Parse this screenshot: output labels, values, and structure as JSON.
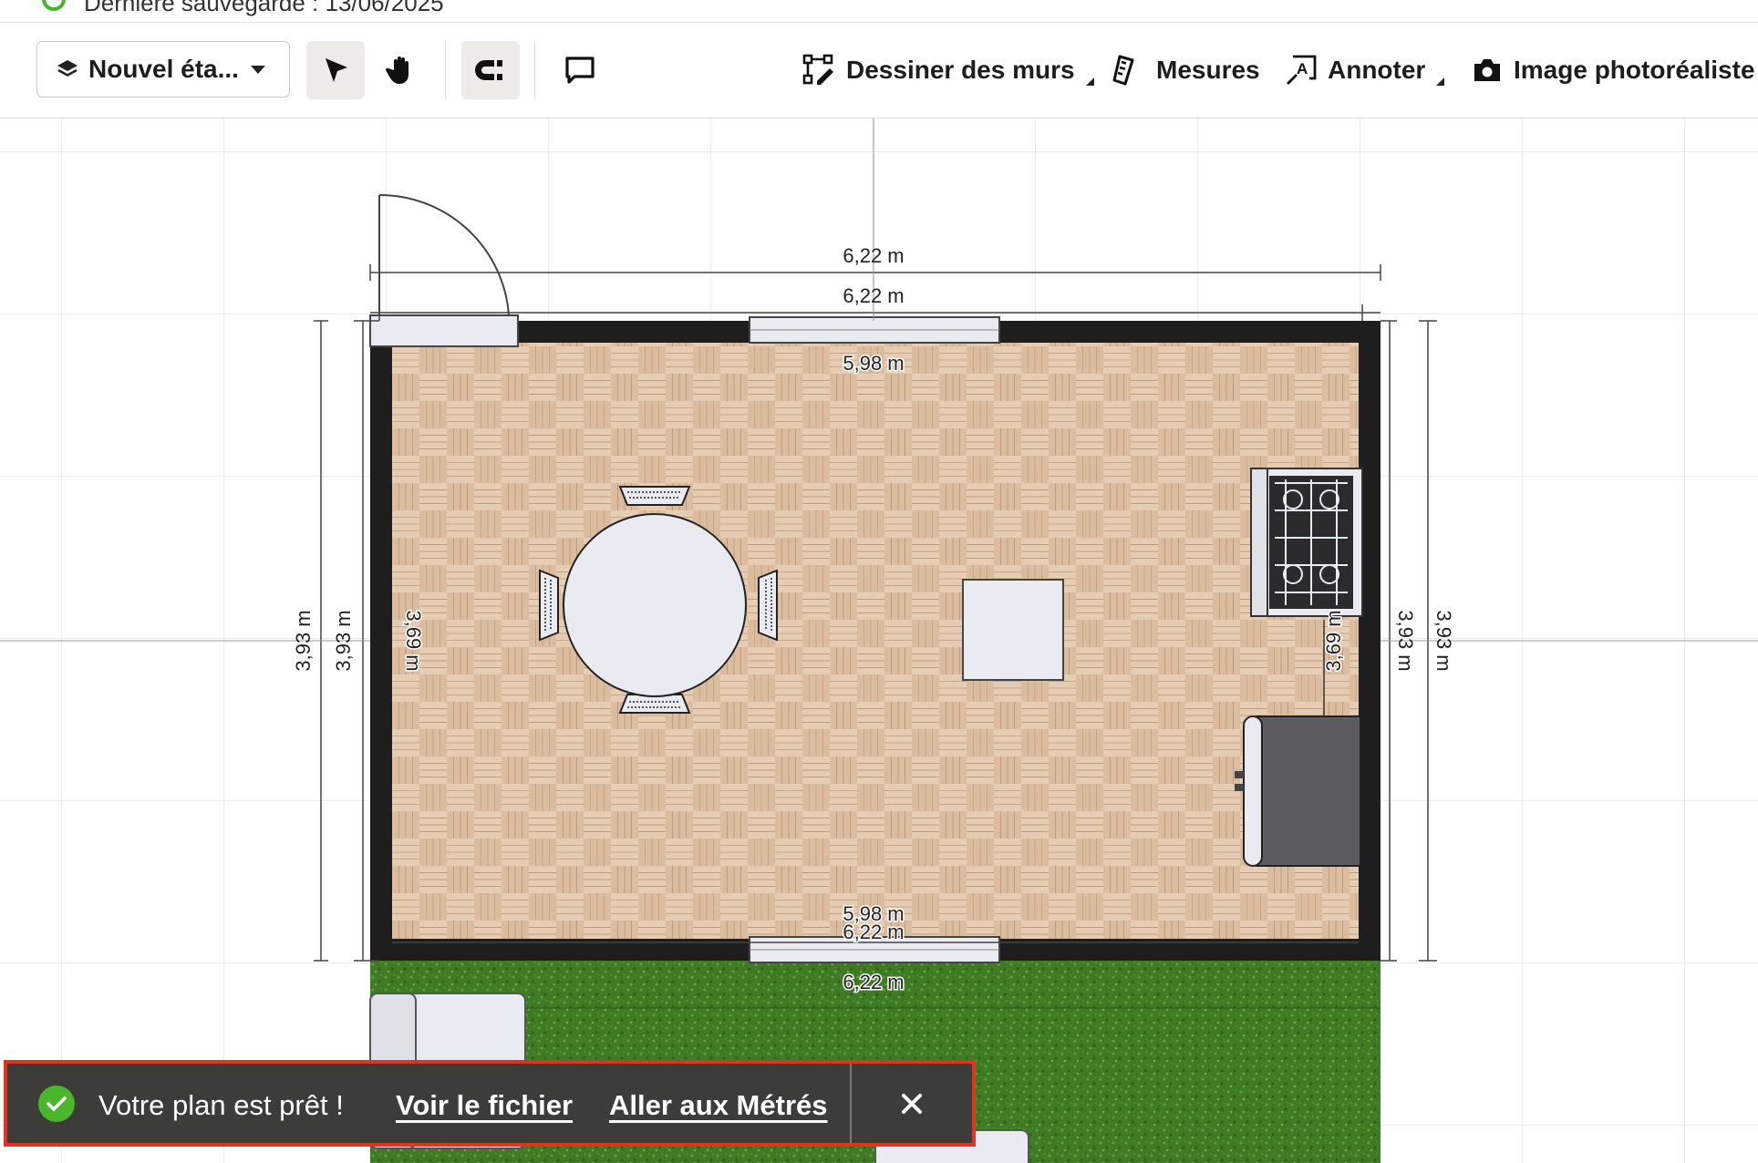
{
  "save_status": {
    "text": "Dernière sauvegarde : 13/06/2025"
  },
  "toolbar": {
    "level_select": "Nouvel éta...",
    "select_tool_icon": "cursor-arrow-icon",
    "pan_tool_icon": "hand-icon",
    "magnet_tool_icon": "magnet-icon",
    "comment_tool_icon": "comment-icon",
    "draw_walls": "Dessiner des murs",
    "measures": "Mesures",
    "annotate": "Annoter",
    "photo_image": "Image photoréaliste"
  },
  "plan": {
    "dimensions": {
      "outer_top": "6,22 m",
      "inner_top": "6,22 m",
      "interior_top": "5,98 m",
      "left_outer": "3,93 m",
      "left_inner": "3,93 m",
      "left_interior": "3,69 m",
      "right_interior": "3,69 m",
      "right_inner": "3,93 m",
      "right_outer": "3,93 m",
      "interior_bottom": "5,98 m",
      "bottom_wall": "6,22 m",
      "garden_width": "6,22 m"
    },
    "colors": {
      "floor": "#d9b99a",
      "wall": "#1e1e1e",
      "grass": "#3f7a25",
      "furniture": "#e9eaf2"
    }
  },
  "toast": {
    "message": "Votre plan est prêt !",
    "view_file_link": "Voir le fichier",
    "quantities_link": "Aller aux Métrés",
    "close_icon": "close-icon"
  }
}
